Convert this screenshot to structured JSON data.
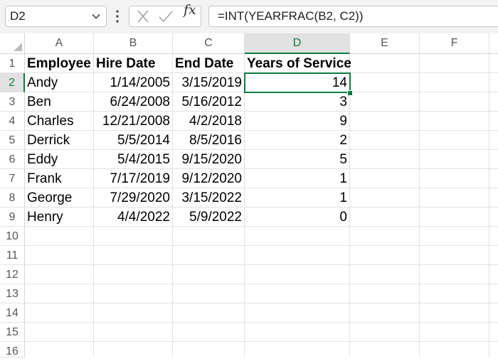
{
  "name_box": {
    "value": "D2"
  },
  "formula_bar": {
    "formula": "=INT(YEARFRAC(B2, C2))"
  },
  "columns": [
    "A",
    "B",
    "C",
    "D",
    "E",
    "F"
  ],
  "rows": [
    "1",
    "2",
    "3",
    "4",
    "5",
    "6",
    "7",
    "8",
    "9",
    "10",
    "11",
    "12",
    "13",
    "14",
    "15",
    "16"
  ],
  "selected": {
    "column": "D",
    "row": "2"
  },
  "table": {
    "headers": [
      "Employee",
      "Hire Date",
      "End Date",
      "Years of Service"
    ],
    "rows": [
      [
        "Andy",
        "1/14/2005",
        "3/15/2019",
        "14"
      ],
      [
        "Ben",
        "6/24/2008",
        "5/16/2012",
        "3"
      ],
      [
        "Charles",
        "12/21/2008",
        "4/2/2018",
        "9"
      ],
      [
        "Derrick",
        "5/5/2014",
        "8/5/2016",
        "2"
      ],
      [
        "Eddy",
        "5/4/2015",
        "9/15/2020",
        "5"
      ],
      [
        "Frank",
        "7/17/2019",
        "9/12/2020",
        "1"
      ],
      [
        "George",
        "7/29/2020",
        "3/15/2022",
        "1"
      ],
      [
        "Henry",
        "4/4/2022",
        "5/9/2022",
        "0"
      ]
    ]
  },
  "colors": {
    "accent": "#107c41",
    "header_bg": "#e1e1e1"
  }
}
